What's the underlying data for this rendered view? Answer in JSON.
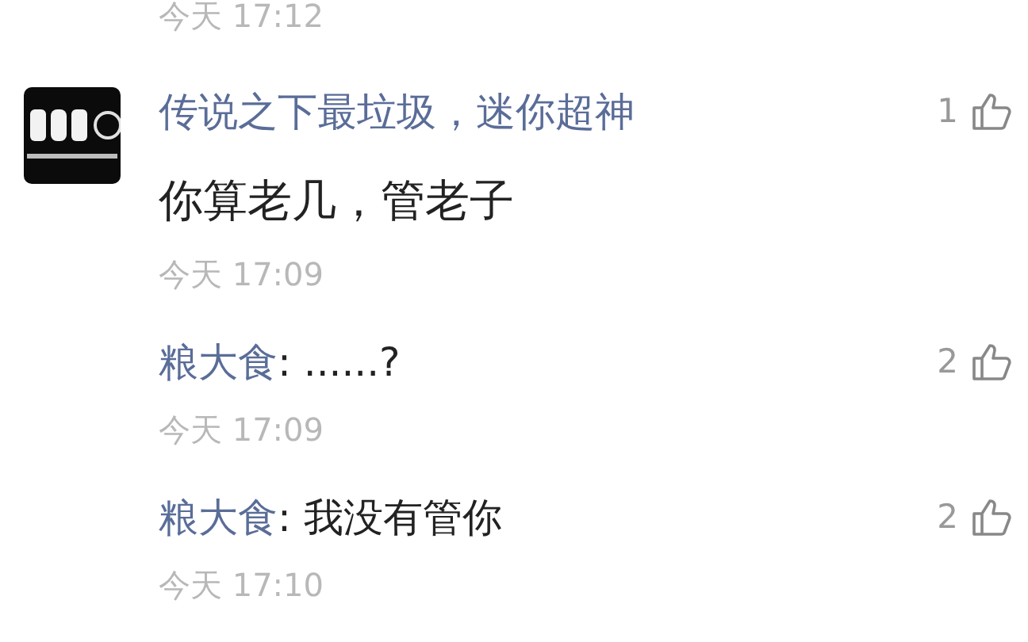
{
  "top_time": "今天 17:12",
  "comment": {
    "kind": "picture",
    "author": "传说之下最垃圾，迷你超神",
    "text": "你算老几，管老子",
    "time": "今天 17:09",
    "likes": "1",
    "replies": [
      {
        "author": "粮大食",
        "text": ": ......?",
        "time": "今天 17:09",
        "likes": "2"
      },
      {
        "author": "粮大食",
        "text": ": 我没有管你",
        "time": "今天 17:10",
        "likes": "2"
      }
    ]
  }
}
